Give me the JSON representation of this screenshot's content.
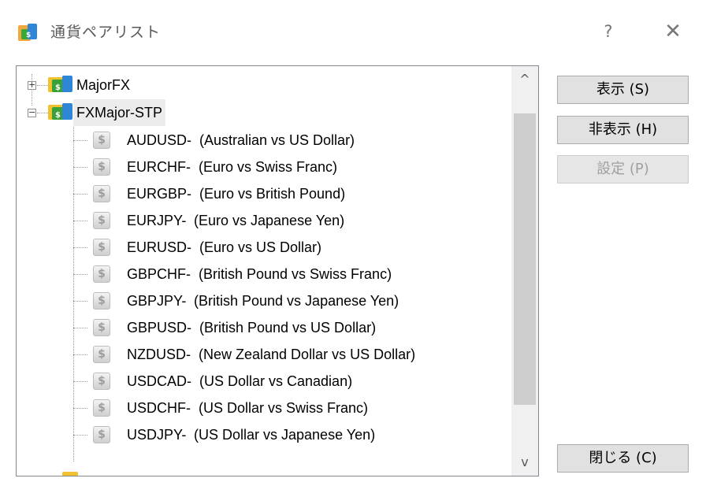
{
  "window": {
    "title": "通貨ペアリスト",
    "help_label": "?",
    "close_label": "✕"
  },
  "tree": {
    "groups": [
      {
        "label": "MajorFX",
        "expander": "+"
      },
      {
        "label": "FXMajor-STP",
        "expander": "−"
      }
    ],
    "items": [
      {
        "symbol": "AUDUSD-",
        "description": "(Australian vs US Dollar)"
      },
      {
        "symbol": "EURCHF-",
        "description": "(Euro vs Swiss Franc)"
      },
      {
        "symbol": "EURGBP-",
        "description": "(Euro vs British Pound)"
      },
      {
        "symbol": "EURJPY-",
        "description": "(Euro vs Japanese Yen)"
      },
      {
        "symbol": "EURUSD-",
        "description": "(Euro vs US Dollar)"
      },
      {
        "symbol": "GBPCHF-",
        "description": "(British Pound vs Swiss Franc)"
      },
      {
        "symbol": "GBPJPY-",
        "description": "(British Pound vs Japanese Yen)"
      },
      {
        "symbol": "GBPUSD-",
        "description": "(British Pound vs US Dollar)"
      },
      {
        "symbol": "NZDUSD-",
        "description": "(New Zealand Dollar vs US Dollar)"
      },
      {
        "symbol": "USDCAD-",
        "description": "(US Dollar vs Canadian)"
      },
      {
        "symbol": "USDCHF-",
        "description": "(US Dollar vs Swiss Franc)"
      },
      {
        "symbol": "USDJPY-",
        "description": "(US Dollar vs Japanese Yen)"
      }
    ],
    "symbol_icon_glyph": "$"
  },
  "scrollbar": {
    "up": "^",
    "down": "v"
  },
  "buttons": {
    "show": "表示 (S)",
    "hide": "非表示 (H)",
    "settings": "設定 (P)",
    "close": "閉じる (C)"
  },
  "colors": {
    "folder_yellow": "#f2c12e",
    "folder_green": "#3aa13a",
    "folder_blue": "#2f86d6",
    "selection": "#ececec"
  }
}
